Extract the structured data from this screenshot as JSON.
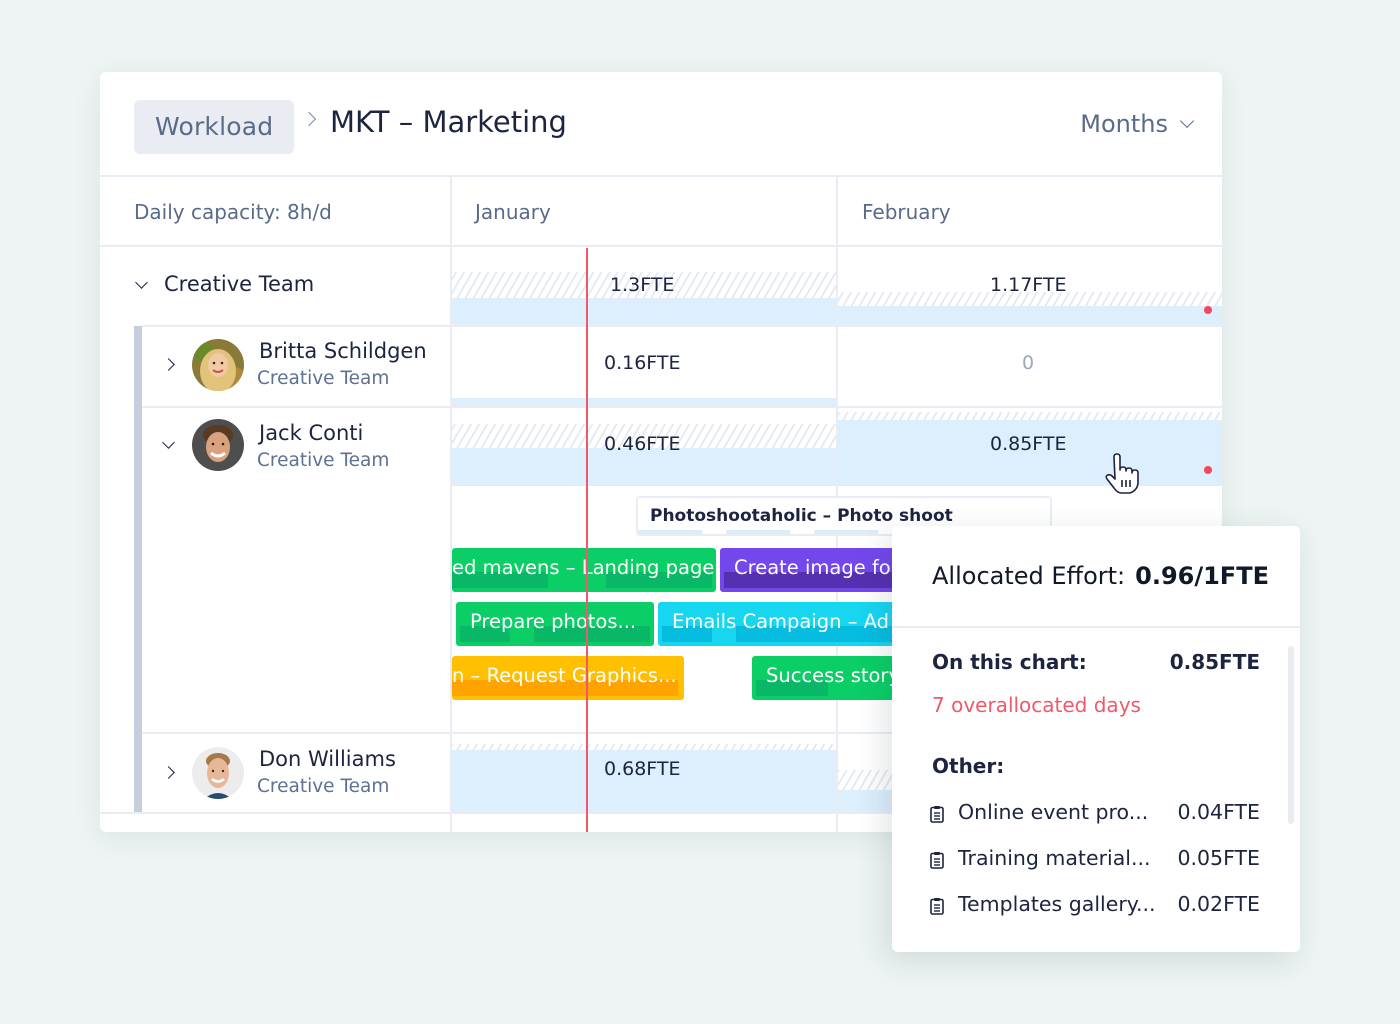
{
  "header": {
    "breadcrumb_root": "Workload",
    "title": "MKT – Marketing",
    "view_selector": "Months"
  },
  "grid": {
    "capacity_label": "Daily capacity: 8h/d",
    "months": [
      "January",
      "February"
    ]
  },
  "team": {
    "name": "Creative Team",
    "expanded": true,
    "january": "1.3FTE",
    "february": "1.17FTE",
    "february_overallocated": true
  },
  "members": [
    {
      "name": "Britta Schildgen",
      "team": "Creative Team",
      "expanded": false,
      "january": "0.16FTE",
      "february": "0"
    },
    {
      "name": "Jack Conti",
      "team": "Creative Team",
      "expanded": true,
      "january": "0.46FTE",
      "february": "0.85FTE",
      "february_overallocated": true
    },
    {
      "name": "Don Williams",
      "team": "Creative Team",
      "expanded": false,
      "january": "0.68FTE",
      "february": ""
    }
  ],
  "tasks": [
    {
      "label": "Photoshootaholic – Photo shoot",
      "style": "outline"
    },
    {
      "label": "ed mavens – Landing page",
      "color": "#0bce67"
    },
    {
      "label": "Create image fo",
      "color": "#7447ec"
    },
    {
      "label": "Prepare photos...",
      "color": "#0bce67"
    },
    {
      "label": "Emails Campaign – Ad",
      "color": "#17d6f0"
    },
    {
      "label": "n – Request Graphics...",
      "color": "#fec000"
    },
    {
      "label": "Success story",
      "color": "#0bce67"
    }
  ],
  "popover": {
    "title_label": "Allocated Effort:",
    "title_value": "0.96/1FTE",
    "on_chart_label": "On this chart:",
    "on_chart_value": "0.85FTE",
    "overallocated": "7 overallocated days",
    "other_label": "Other:",
    "other_items": [
      {
        "name": "Online event pro...",
        "value": "0.04FTE",
        "icon": "clipboard-icon"
      },
      {
        "name": "Training material...",
        "value": "0.05FTE",
        "icon": "clipboard-icon"
      },
      {
        "name": "Templates gallery...",
        "value": "0.02FTE",
        "icon": "clipboard-icon"
      }
    ]
  },
  "colors": {
    "accent_red": "#f0596a",
    "capacity_fill": "#ddeefc",
    "green": "#0bce67",
    "purple": "#7447ec",
    "cyan": "#17d6f0",
    "orange": "#fec000"
  }
}
